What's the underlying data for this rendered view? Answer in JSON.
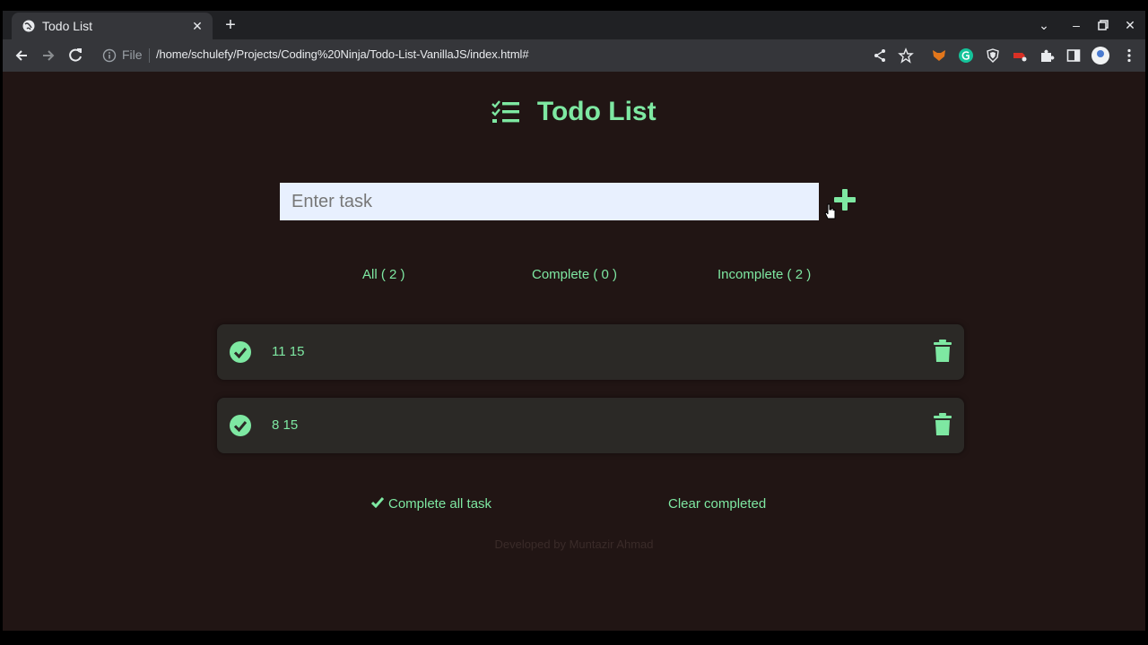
{
  "browser": {
    "tab_title": "Todo List",
    "address": {
      "scheme_label": "File",
      "url": "/home/schulefy/Projects/Coding%20Ninja/Todo-List-VanillaJS/index.html#"
    }
  },
  "app": {
    "title": "Todo List",
    "input_placeholder": "Enter task",
    "filters": [
      {
        "label": "All ( 2 )"
      },
      {
        "label": "Complete ( 0 )"
      },
      {
        "label": "Incomplete ( 2 )"
      }
    ],
    "tasks": [
      {
        "text": "11 15",
        "completed": false
      },
      {
        "text": "8 15",
        "completed": false
      }
    ],
    "complete_all_label": "Complete all task",
    "clear_completed_label": "Clear completed",
    "credit": "Developed by Muntazir Ahmad"
  },
  "colors": {
    "accent": "#7ee8a2",
    "page_background": "#211514",
    "item_background": "#2b2926"
  }
}
